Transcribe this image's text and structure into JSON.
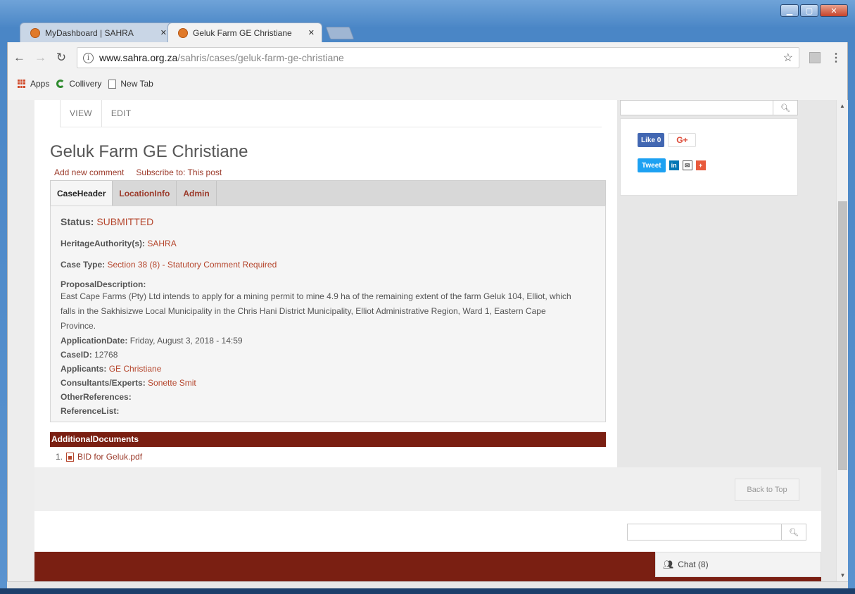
{
  "browser": {
    "tabs": [
      {
        "title": "MyDashboard | SAHRA",
        "active": false
      },
      {
        "title": "Geluk Farm GE Christiane",
        "active": true
      }
    ],
    "url_host": "www.sahra.org.za",
    "url_path": "/sahris/cases/geluk-farm-ge-christiane",
    "bookmarks": [
      "Apps",
      "Collivery",
      "New Tab"
    ]
  },
  "page": {
    "view_tabs": [
      "VIEW",
      "EDIT"
    ],
    "title": "Geluk Farm GE Christiane",
    "links": [
      "Add new comment",
      "Subscribe to: This post"
    ],
    "case_tabs": [
      "CaseHeader",
      "LocationInfo",
      "Admin"
    ],
    "status_label": "Status:",
    "status_value": "SUBMITTED",
    "heritage_label": "HeritageAuthority(s):",
    "heritage_value": "SAHRA",
    "case_type_label": "Case Type:",
    "case_type_value": "Section 38 (8) - Statutory Comment Required",
    "proposal_label": "ProposalDescription:",
    "proposal_text": "East Cape Farms (Pty) Ltd intends to apply for a mining permit to mine 4.9 ha of the remaining extent of the farm Geluk 104, Elliot, which falls in the Sakhisizwe Local Municipality in the Chris Hani District Municipality, Elliot Administrative Region, Ward 1, Eastern Cape Province.",
    "application_date_label": "ApplicationDate:",
    "application_date_value": "Friday, August 3, 2018 - 14:59",
    "case_id_label": "CaseID:",
    "case_id_value": "12768",
    "applicants_label": "Applicants:",
    "applicants_value": "GE Christiane",
    "consultants_label": "Consultants/Experts:",
    "consultants_value": "Sonette Smit",
    "other_refs_label": "OtherReferences:",
    "ref_list_label": "ReferenceList:",
    "docs_header": "AdditionalDocuments",
    "doc_number": "1.",
    "doc_name": "BID for Geluk.pdf"
  },
  "sidebar": {
    "fb_like": "Like 0",
    "gplus": "G+",
    "tweet": "Tweet"
  },
  "footer": {
    "back_to_top": "Back to Top",
    "chat": "Chat (8)"
  },
  "colors": {
    "brand": "#7a1f12",
    "link": "#9b3a2a"
  }
}
